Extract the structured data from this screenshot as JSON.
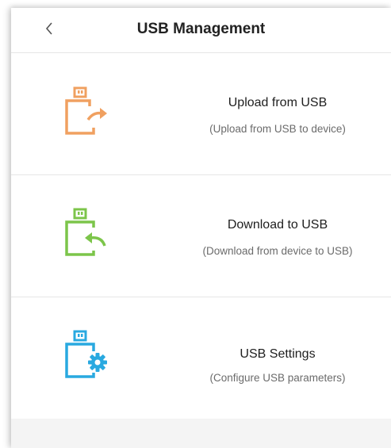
{
  "header": {
    "title": "USB Management",
    "back_icon": "chevron-left-icon"
  },
  "items": [
    {
      "label": "Upload from USB",
      "description": "(Upload from USB to device)",
      "icon": "usb-upload-icon",
      "color": "#F0A060"
    },
    {
      "label": "Download to USB",
      "description": "(Download from device to USB)",
      "icon": "usb-download-icon",
      "color": "#7CC54A"
    },
    {
      "label": "USB Settings",
      "description": "(Configure USB parameters)",
      "icon": "usb-settings-icon",
      "color": "#29A9E0"
    }
  ]
}
